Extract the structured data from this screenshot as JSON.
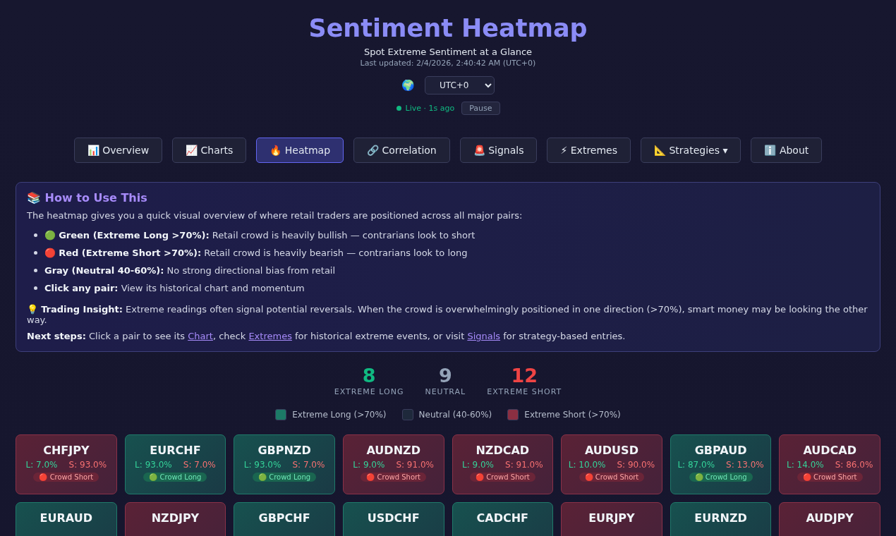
{
  "header": {
    "title": "Sentiment Heatmap",
    "subtitle": "Spot Extreme Sentiment at a Glance",
    "updated": "Last updated: 2/4/2026, 2:40:42 AM (UTC+0)",
    "globe": "🌍",
    "timezone": "UTC+0",
    "live": "Live · 1s ago",
    "pause": "Pause"
  },
  "tabs": [
    {
      "label": "📊 Overview",
      "selected": false
    },
    {
      "label": "📈 Charts",
      "selected": false
    },
    {
      "label": "🔥 Heatmap",
      "selected": true
    },
    {
      "label": "🔗 Correlation",
      "selected": false
    },
    {
      "label": "🚨 Signals",
      "selected": false
    },
    {
      "label": "⚡ Extremes",
      "selected": false
    },
    {
      "label": "📐 Strategies ▾",
      "selected": false
    },
    {
      "label": "ℹ️ About",
      "selected": false
    }
  ],
  "help": {
    "title": "📚 How to Use This",
    "intro": "The heatmap gives you a quick visual overview of where retail traders are positioned across all major pairs:",
    "bullets": [
      "🟢 **Green (Extreme Long >70%):** Retail crowd is heavily bullish — contrarians look to short",
      "🔴 **Red (Extreme Short >70%):** Retail crowd is heavily bearish — contrarians look to long",
      "**Gray (Neutral 40-60%):** No strong directional bias from retail",
      "**Click any pair:** View its historical chart and momentum"
    ],
    "insight": "💡 **Trading Insight:** Extreme readings often signal potential reversals. When the crowd is overwhelmingly positioned in one direction (>70%), smart money may be looking the other way.",
    "next_steps": [
      {
        "kind": "bold",
        "text": "Next steps:"
      },
      {
        "kind": "text",
        "text": " Click a pair to see its "
      },
      {
        "kind": "link",
        "text": "Chart"
      },
      {
        "kind": "text",
        "text": ", check "
      },
      {
        "kind": "link",
        "text": "Extremes"
      },
      {
        "kind": "text",
        "text": " for historical extreme events, or visit "
      },
      {
        "kind": "link",
        "text": "Signals"
      },
      {
        "kind": "text",
        "text": " for strategy-based entries."
      }
    ]
  },
  "stats": [
    {
      "kind": "long",
      "value": "8",
      "label": "EXTREME LONG"
    },
    {
      "kind": "neutral",
      "value": "9",
      "label": "NEUTRAL"
    },
    {
      "kind": "short",
      "value": "12",
      "label": "EXTREME SHORT"
    }
  ],
  "legend": [
    {
      "kind": "long",
      "label": "Extreme Long (>70%)"
    },
    {
      "kind": "neutral",
      "label": "Neutral (40-60%)"
    },
    {
      "kind": "short",
      "label": "Extreme Short (>70%)"
    }
  ],
  "pairs": [
    {
      "kind": "short",
      "pair": "CHFJPY",
      "long": "L: 7.0%",
      "short": "S: 93.0%",
      "badge": "🔴 Crowd Short"
    },
    {
      "kind": "long",
      "pair": "EURCHF",
      "long": "L: 93.0%",
      "short": "S: 7.0%",
      "badge": "🟢 Crowd Long"
    },
    {
      "kind": "long",
      "pair": "GBPNZD",
      "long": "L: 93.0%",
      "short": "S: 7.0%",
      "badge": "🟢 Crowd Long"
    },
    {
      "kind": "short",
      "pair": "AUDNZD",
      "long": "L: 9.0%",
      "short": "S: 91.0%",
      "badge": "🔴 Crowd Short"
    },
    {
      "kind": "short",
      "pair": "NZDCAD",
      "long": "L: 9.0%",
      "short": "S: 91.0%",
      "badge": "🔴 Crowd Short"
    },
    {
      "kind": "short",
      "pair": "AUDUSD",
      "long": "L: 10.0%",
      "short": "S: 90.0%",
      "badge": "🔴 Crowd Short"
    },
    {
      "kind": "long",
      "pair": "GBPAUD",
      "long": "L: 87.0%",
      "short": "S: 13.0%",
      "badge": "🟢 Crowd Long"
    },
    {
      "kind": "short",
      "pair": "AUDCAD",
      "long": "L: 14.0%",
      "short": "S: 86.0%",
      "badge": "🔴 Crowd Short"
    },
    {
      "kind": "long",
      "pair": "EURAUD"
    },
    {
      "kind": "short",
      "pair": "NZDJPY"
    },
    {
      "kind": "long",
      "pair": "GBPCHF"
    },
    {
      "kind": "long",
      "pair": "USDCHF"
    },
    {
      "kind": "long",
      "pair": "CADCHF"
    },
    {
      "kind": "short",
      "pair": "EURJPY"
    },
    {
      "kind": "long",
      "pair": "EURNZD"
    },
    {
      "kind": "short",
      "pair": "AUDJPY"
    }
  ]
}
